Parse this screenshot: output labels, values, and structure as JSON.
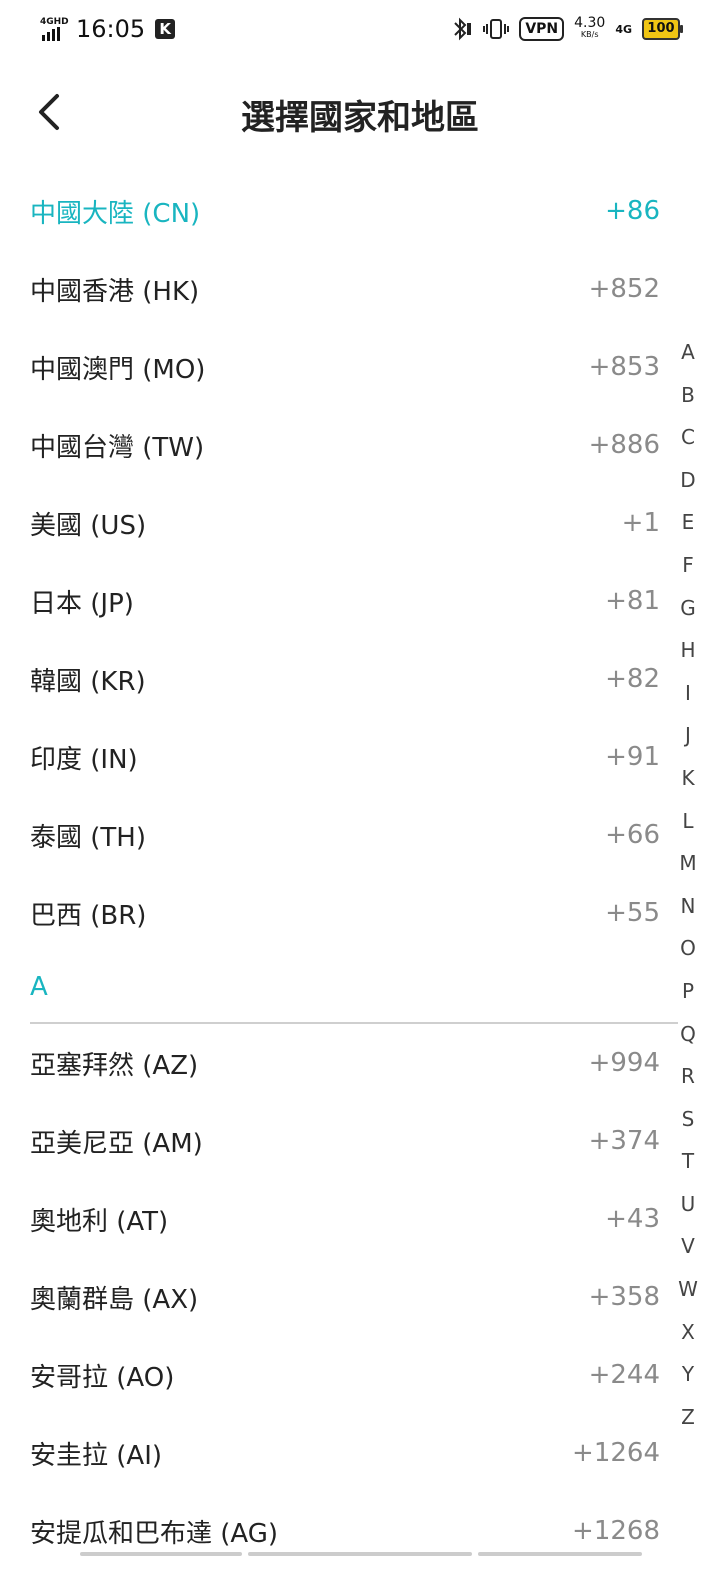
{
  "status_bar": {
    "network_tag": "4GHD",
    "time": "16:05",
    "k_label": "K",
    "vpn": "VPN",
    "speed_value": "4.30",
    "speed_unit": "KB/s",
    "net_type": "4G",
    "battery": "100"
  },
  "header": {
    "title": "選擇國家和地區"
  },
  "hot_list": [
    {
      "name": "中國大陸  (CN)",
      "code": "+86",
      "selected": true
    },
    {
      "name": "中國香港  (HK)",
      "code": "+852"
    },
    {
      "name": "中國澳門  (MO)",
      "code": "+853"
    },
    {
      "name": "中國台灣  (TW)",
      "code": "+886"
    },
    {
      "name": "美國  (US)",
      "code": "+1"
    },
    {
      "name": "日本  (JP)",
      "code": "+81"
    },
    {
      "name": "韓國  (KR)",
      "code": "+82"
    },
    {
      "name": "印度  (IN)",
      "code": "+91"
    },
    {
      "name": "泰國  (TH)",
      "code": "+66"
    },
    {
      "name": "巴西  (BR)",
      "code": "+55"
    }
  ],
  "section_a": {
    "label": "A",
    "items": [
      {
        "name": "亞塞拜然  (AZ)",
        "code": "+994"
      },
      {
        "name": "亞美尼亞  (AM)",
        "code": "+374"
      },
      {
        "name": "奧地利  (AT)",
        "code": "+43"
      },
      {
        "name": "奧蘭群島  (AX)",
        "code": "+358"
      },
      {
        "name": "安哥拉  (AO)",
        "code": "+244"
      },
      {
        "name": "安圭拉  (AI)",
        "code": "+1264"
      },
      {
        "name": "安提瓜和巴布達  (AG)",
        "code": "+1268"
      }
    ]
  },
  "index_letters": [
    "A",
    "B",
    "C",
    "D",
    "E",
    "F",
    "G",
    "H",
    "I",
    "J",
    "K",
    "L",
    "M",
    "N",
    "O",
    "P",
    "Q",
    "R",
    "S",
    "T",
    "U",
    "V",
    "W",
    "X",
    "Y",
    "Z"
  ],
  "colors": {
    "accent": "#19b5c0",
    "code_gray": "#8a8a8a",
    "text": "#222222"
  }
}
